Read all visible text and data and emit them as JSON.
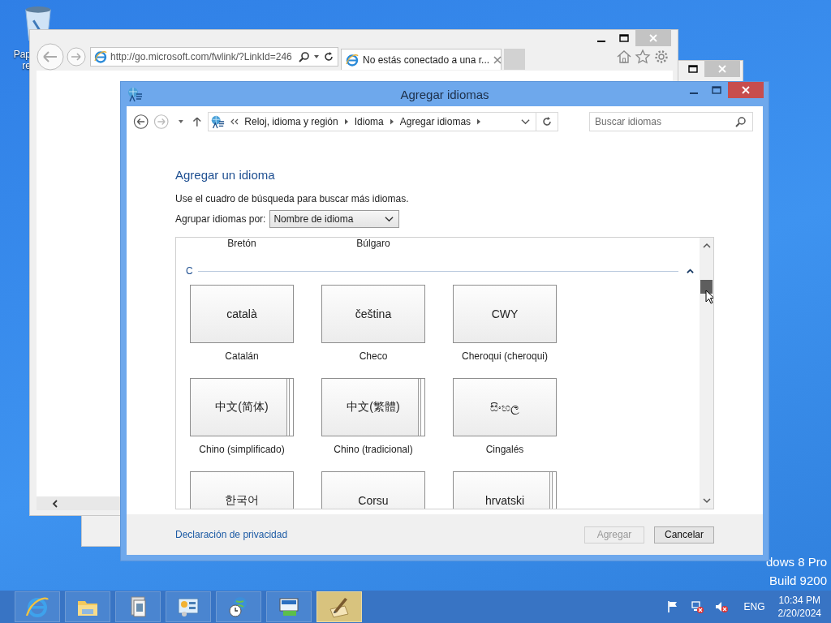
{
  "desktop": {
    "recycle_label": [
      "Pap",
      "re"
    ],
    "watermark": [
      "dows 8 Pro",
      "Build 9200"
    ]
  },
  "browser": {
    "address": "http://go.microsoft.com/fwlink/?LinkId=246",
    "tab_title": "No estás conectado a una r..."
  },
  "dialog": {
    "title": "Agregar idiomas",
    "breadcrumb": [
      "Reloj, idioma y región",
      "Idioma",
      "Agregar idiomas"
    ],
    "search": {
      "placeholder": "Buscar idiomas"
    },
    "heading": "Agregar un idioma",
    "hint": "Use el cuadro de búsqueda para buscar más idiomas.",
    "group_label": "Agrupar idiomas por:",
    "group_value": "Nombre de idioma",
    "previous_names": [
      "Bretón",
      "Búlgaro"
    ],
    "section": {
      "letter": "C",
      "expanded": true
    },
    "tiles": [
      {
        "native": "català",
        "name": "Catalán",
        "variants": false
      },
      {
        "native": "čeština",
        "name": "Checo",
        "variants": false
      },
      {
        "native": "CWY",
        "name": "Cheroqui (cheroqui)",
        "variants": false
      },
      {
        "native": "中文(简体)",
        "name": "Chino (simplificado)",
        "variants": true
      },
      {
        "native": "中文(繁體)",
        "name": "Chino (tradicional)",
        "variants": true
      },
      {
        "native": "සිංහල",
        "name": "Cingalés",
        "variants": false
      },
      {
        "native": "한국어",
        "variants": false
      },
      {
        "native": "Corsu",
        "variants": false
      },
      {
        "native": "hrvatski",
        "variants": true
      }
    ],
    "privacy_link": "Declaración de privacidad",
    "buttons": [
      {
        "label": "Agregar",
        "disabled": true
      },
      {
        "label": "Cancelar",
        "disabled": false
      }
    ]
  },
  "taskbar": {
    "apps": [
      {
        "kind": "browser",
        "selected": false
      },
      {
        "kind": "folder",
        "selected": false
      },
      {
        "kind": "documents",
        "selected": false
      },
      {
        "kind": "panel",
        "selected": false
      },
      {
        "kind": "globe",
        "selected": false
      },
      {
        "kind": "network",
        "selected": false
      },
      {
        "kind": "pen",
        "selected": true
      }
    ],
    "language": "ENG",
    "time": "10:34 PM",
    "date": "2/20/2024"
  }
}
